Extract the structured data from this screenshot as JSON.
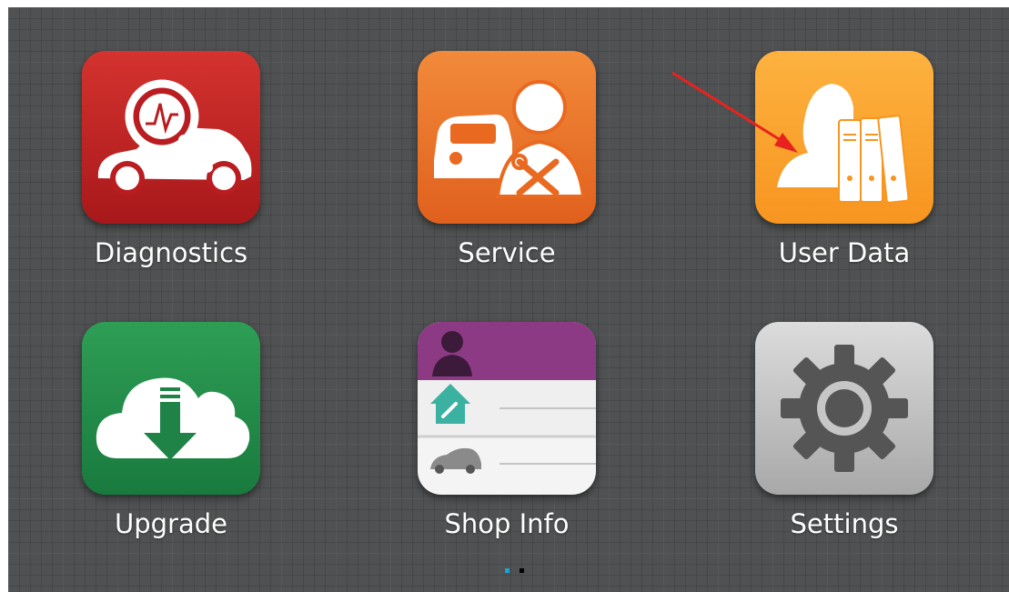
{
  "apps": [
    {
      "label": "Diagnostics",
      "icon": "car-diagnostics-icon",
      "color": "#c0262a"
    },
    {
      "label": "Service",
      "icon": "car-service-technician-icon",
      "color": "#ec7429"
    },
    {
      "label": "User Data",
      "icon": "user-binders-icon",
      "color": "#fba22f"
    },
    {
      "label": "Upgrade",
      "icon": "cloud-download-icon",
      "color": "#238c4a"
    },
    {
      "label": "Shop Info",
      "icon": "shop-info-card-icon",
      "color": "#8d3a84"
    },
    {
      "label": "Settings",
      "icon": "gear-icon",
      "color": "#c3c3c3"
    }
  ],
  "pager": {
    "pages": 2,
    "current": 1,
    "active_color": "#1ba3d6"
  },
  "annotation": {
    "icon": "red-arrow-icon",
    "color": "#e8231f",
    "target": "User Data"
  }
}
